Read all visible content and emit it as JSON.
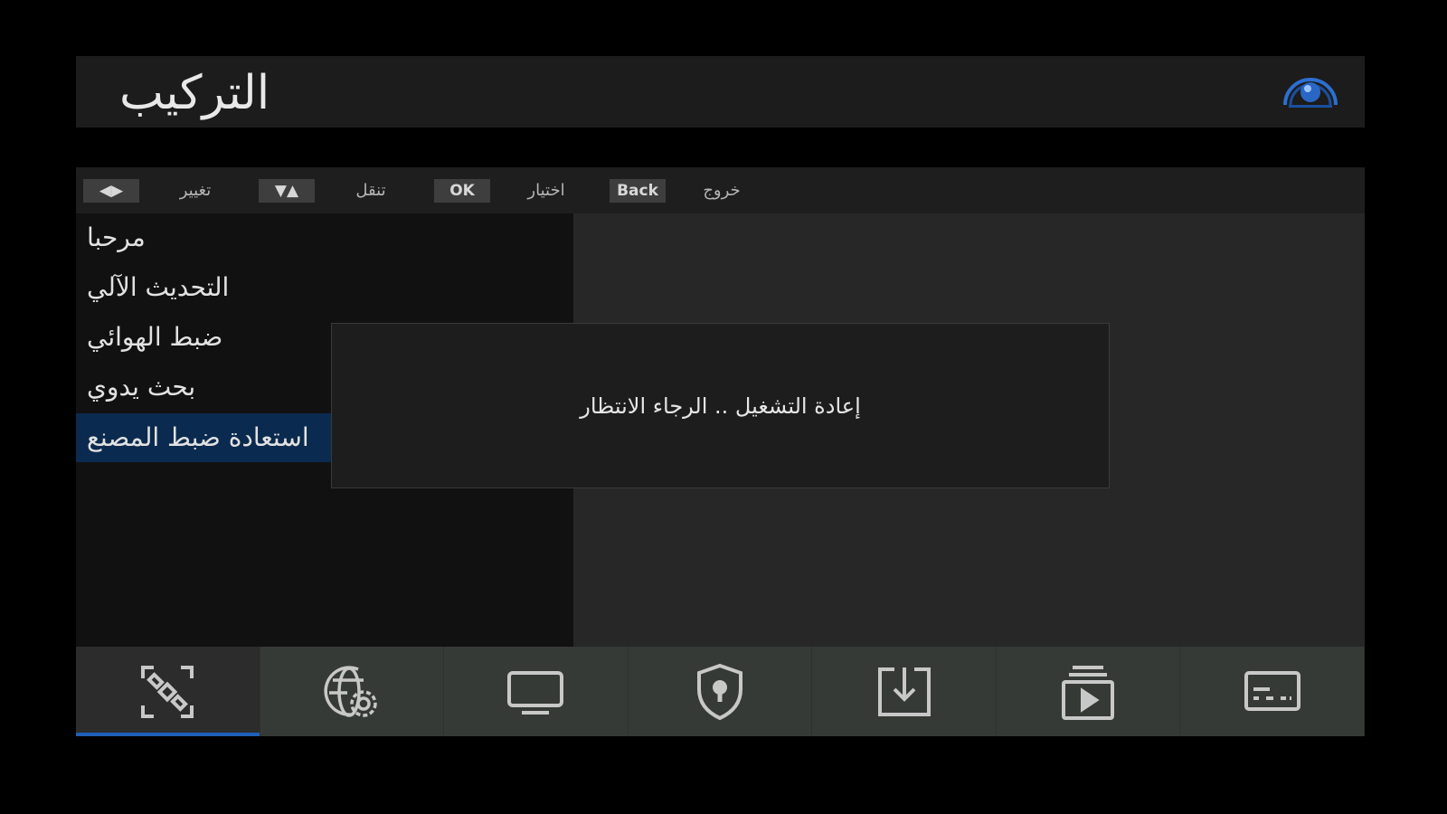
{
  "header": {
    "title": "التركيب"
  },
  "helpbar": {
    "items": [
      {
        "key": "◀▶",
        "label": "تغيير"
      },
      {
        "key": "▼▲",
        "label": "تنقل"
      },
      {
        "key": "OK",
        "label": "اختيار"
      },
      {
        "key": "Back",
        "label": "خروج"
      }
    ]
  },
  "menu": {
    "items": [
      {
        "label": "مرحبا"
      },
      {
        "label": "التحديث الآلي"
      },
      {
        "label": "ضبط الهوائي"
      },
      {
        "label": "بحث يدوي"
      },
      {
        "label": "استعادة ضبط المصنع",
        "selected": true
      }
    ]
  },
  "dialog": {
    "message": "إعادة التشغيل .. الرجاء الانتظار"
  },
  "bottom_tabs": [
    {
      "icon": "satellite-icon",
      "active": true
    },
    {
      "icon": "network-settings-icon"
    },
    {
      "icon": "tv-icon"
    },
    {
      "icon": "parental-lock-icon"
    },
    {
      "icon": "download-icon"
    },
    {
      "icon": "media-player-icon"
    },
    {
      "icon": "subtitles-icon"
    }
  ],
  "colors": {
    "background": "#000000",
    "panel": "#272727",
    "selected": "#0b2a4f",
    "active_tab_underline": "#1f5fb8"
  }
}
